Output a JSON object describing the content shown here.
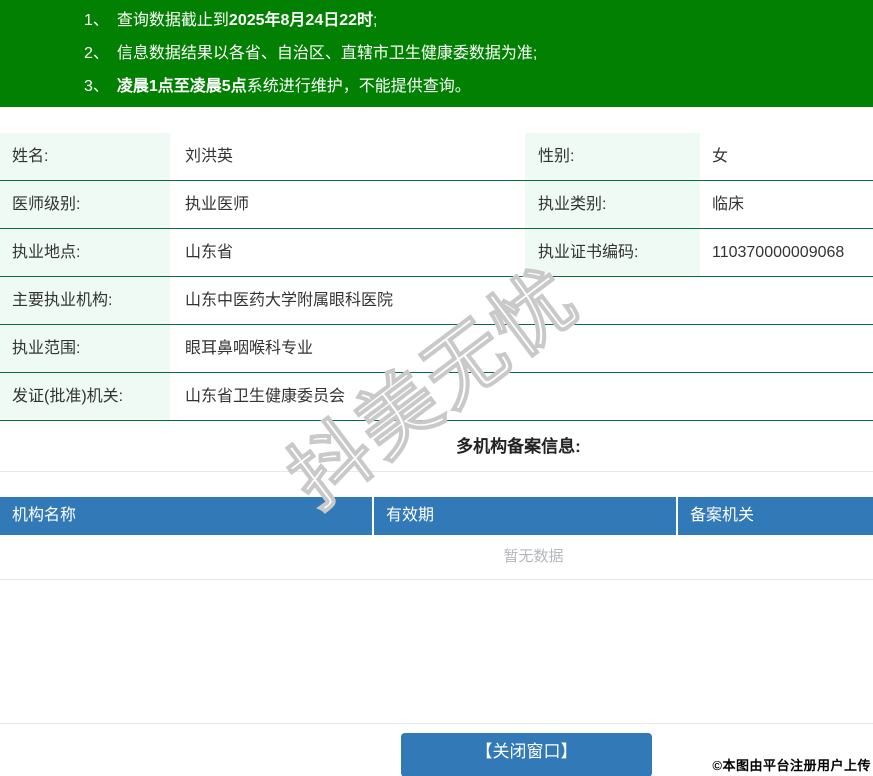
{
  "notice": {
    "items": [
      {
        "num": "1、",
        "pre": "查询数据截止到",
        "bold": "2025年8月24日22时",
        "post": ";"
      },
      {
        "num": "2、",
        "pre": "信息数据结果以各省、自治区、直辖市卫生健康委数据为准;",
        "bold": "",
        "post": ""
      },
      {
        "num": "3、",
        "pre": "",
        "bold": "凌晨1点至凌晨5点",
        "post": "系统进行维护，不能提供查询。"
      }
    ]
  },
  "info": {
    "rows": [
      {
        "cells": [
          {
            "label": "姓名:",
            "value": "刘洪英"
          },
          {
            "label": "性别:",
            "value": "女"
          }
        ]
      },
      {
        "cells": [
          {
            "label": "医师级别:",
            "value": "执业医师"
          },
          {
            "label": "执业类别:",
            "value": "临床"
          }
        ]
      },
      {
        "cells": [
          {
            "label": "执业地点:",
            "value": "山东省"
          },
          {
            "label": "执业证书编码:",
            "value": "110370000009068"
          }
        ]
      },
      {
        "cells": [
          {
            "label": "主要执业机构:",
            "value": "山东中医药大学附属眼科医院"
          }
        ]
      },
      {
        "cells": [
          {
            "label": "执业范围:",
            "value": "眼耳鼻咽喉科专业"
          }
        ]
      },
      {
        "cells": [
          {
            "label": "发证(批准)机关:",
            "value": "山东省卫生健康委员会"
          }
        ]
      }
    ]
  },
  "registration": {
    "title": "多机构备案信息:",
    "headers": [
      "机构名称",
      "有效期",
      "备案机关"
    ],
    "empty_text": "暂无数据"
  },
  "footer": {
    "close_button": "【关闭窗口】",
    "copyright": "©本图由平台注册用户上传"
  },
  "watermark": {
    "text": "抖美无忧"
  },
  "colors": {
    "banner_green": "#018001",
    "row_line_green": "#076e3f",
    "label_bg": "#eefaf3",
    "table_blue": "#3279b7",
    "button_blue": "#3279b7"
  }
}
